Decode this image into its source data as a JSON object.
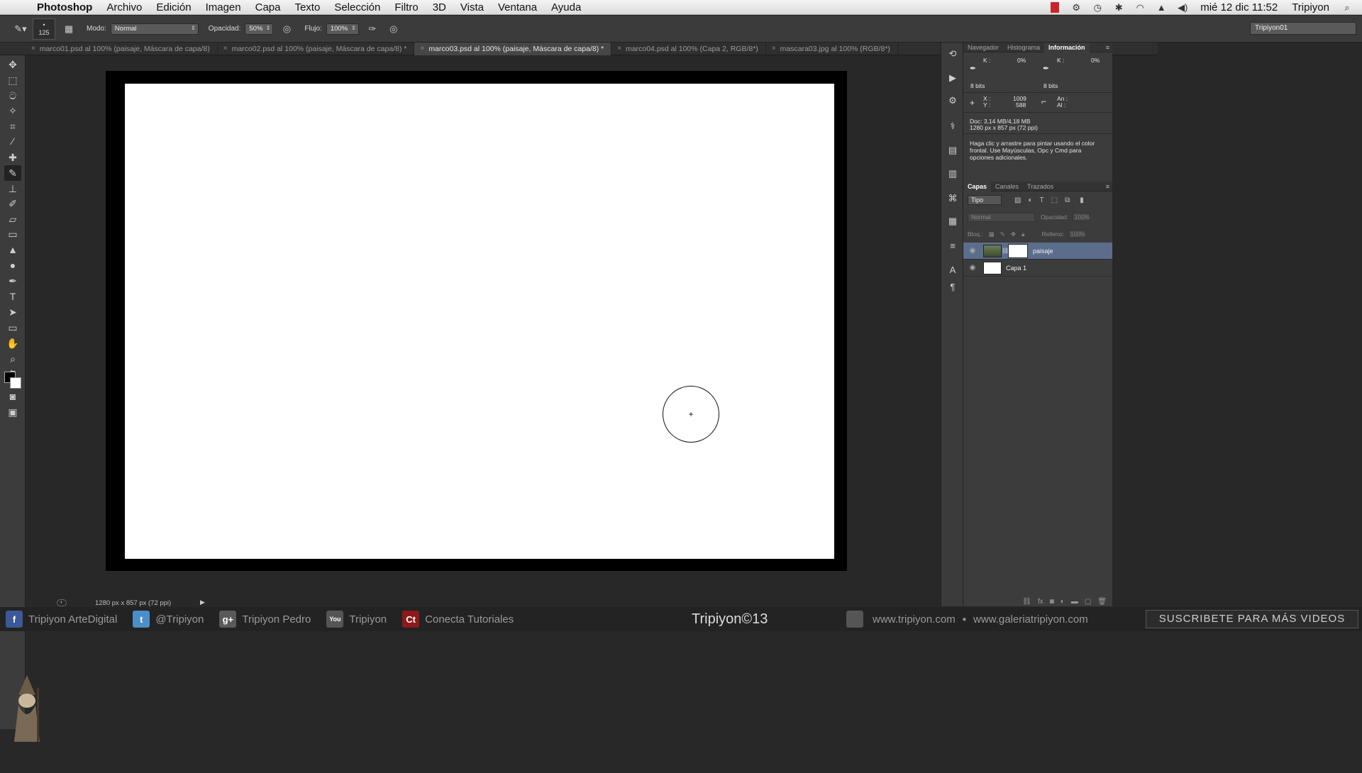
{
  "menubar": {
    "apple_icon": "apple-logo-icon",
    "items": [
      "Photoshop",
      "Archivo",
      "Edición",
      "Imagen",
      "Capa",
      "Texto",
      "Selección",
      "Filtro",
      "3D",
      "Vista",
      "Ventana",
      "Ayuda"
    ],
    "status_icons": [
      "adobe-icon",
      "settings-icon",
      "time-machine-icon",
      "bluetooth-icon",
      "wifi-icon",
      "eject-icon",
      "volume-icon"
    ],
    "datetime": "mié 12 dic  11:52",
    "user": "Tripiyon"
  },
  "options": {
    "brush_size": "125",
    "mode_label": "Modo:",
    "mode_value": "Normal",
    "opacity_label": "Opacidad:",
    "opacity_value": "50%",
    "flow_label": "Flujo:",
    "flow_value": "100%",
    "workspace": "Tripiyon01"
  },
  "tabs": [
    {
      "label": "marco01.psd al 100% (paisaje, Máscara de capa/8)",
      "active": false
    },
    {
      "label": "marco02.psd al 100% (paisaje, Máscara de capa/8) *",
      "active": false
    },
    {
      "label": "marco03.psd al 100% (paisaje, Máscara de capa/8) *",
      "active": true
    },
    {
      "label": "marco04.psd al 100% (Capa 2, RGB/8*)",
      "active": false
    },
    {
      "label": "mascara03.jpg al 100% (RGB/8*)",
      "active": false
    }
  ],
  "status": {
    "doc_size": "1280 px x 857 px (72 ppi)"
  },
  "panels": {
    "info_tabs": [
      "Navegador",
      "Histograma",
      "Información"
    ],
    "info": {
      "k_label": "K :",
      "k_value": "0%",
      "k2_label": "K :",
      "k2_value": "0%",
      "bits": "8 bits",
      "bits2": "8 bits",
      "x_label": "X :",
      "x_value": "1009",
      "y_label": "Y :",
      "y_value": "588",
      "an_label": "An :",
      "al_label": "Al :",
      "doc": "Doc: 3,14 MB/4,18 MB",
      "dims": "1280 px x 857 px (72 ppi)",
      "hint": "Haga clic y arrastre para pintar usando el color frontal. Use Mayúsculas, Opc y Cmd para opciones adicionales."
    },
    "layer_tabs": [
      "Capas",
      "Canales",
      "Trazados"
    ],
    "layers_kind": "Tipo",
    "layers_mode": "Normal",
    "opacity_label": "Opacidad:",
    "opacity_value": "100%",
    "lock_label": "Bloq.:",
    "fill_label": "Relleno:",
    "fill_value": "100%",
    "layers": [
      {
        "name": "paisaje",
        "selected": true
      },
      {
        "name": "Capa 1",
        "selected": false
      }
    ]
  },
  "footer": {
    "facebook": "Tripiyon ArteDigital",
    "twitter": "@Tripiyon",
    "gplus": "Tripiyon Pedro",
    "youtube": "Tripiyon",
    "ct": "Conecta Tutoriales",
    "center": "Tripiyon©13",
    "web1": "www.tripiyon.com",
    "web_sep": "▪",
    "web2": "www.galeriatripiyon.com",
    "subscribe": "SUSCRIBETE PARA MÁS VIDEOS"
  },
  "colors": {
    "selected_layer": "#5c6d8c",
    "foreground": "#000000",
    "background": "#ffffff"
  }
}
